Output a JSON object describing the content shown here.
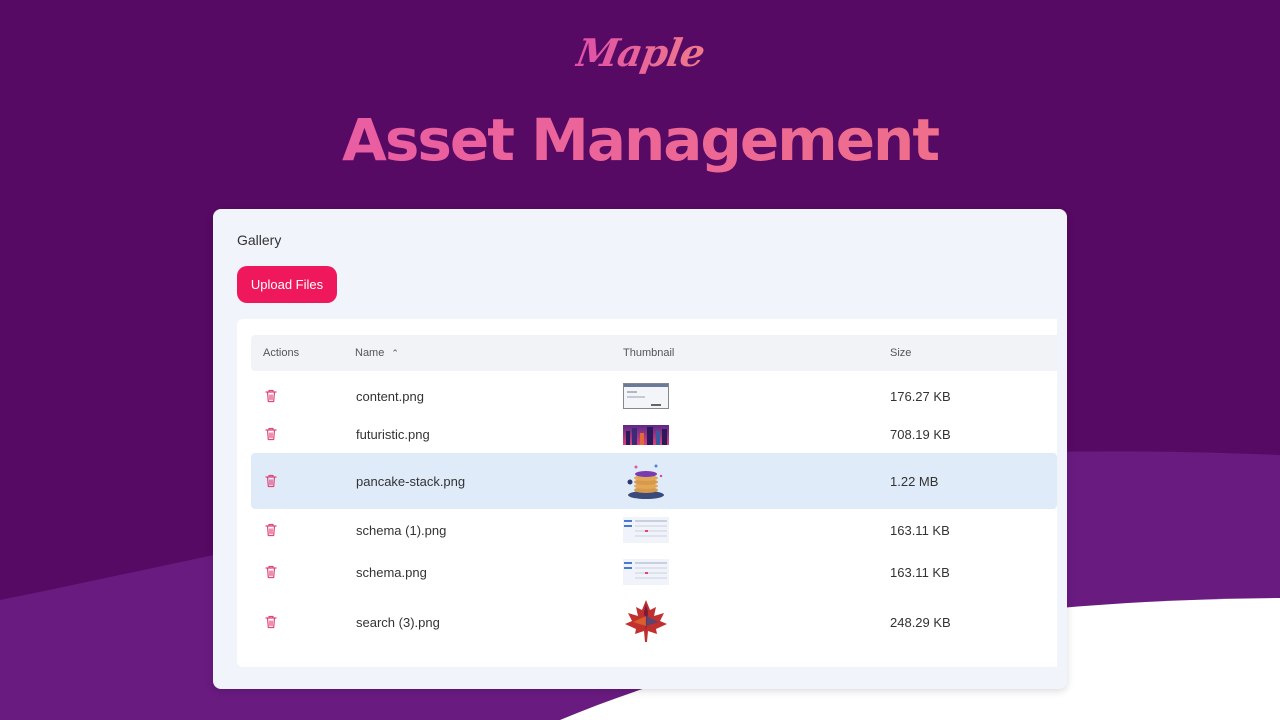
{
  "brand": {
    "logo_text": "Maple"
  },
  "hero": {
    "title": "Asset Management"
  },
  "gallery": {
    "title": "Gallery",
    "upload_label": "Upload Files",
    "columns": {
      "actions": "Actions",
      "name": "Name",
      "thumbnail": "Thumbnail",
      "size": "Size"
    },
    "sort": {
      "column": "Name",
      "direction": "ascending"
    },
    "rows": [
      {
        "name": "content.png",
        "size": "176.27 KB",
        "thumbnail": "screenshot-thumbnail",
        "selected": false
      },
      {
        "name": "futuristic.png",
        "size": "708.19 KB",
        "thumbnail": "city-image-thumbnail",
        "selected": false
      },
      {
        "name": "pancake-stack.png",
        "size": "1.22 MB",
        "thumbnail": "pancake-image-thumbnail",
        "selected": true
      },
      {
        "name": "schema (1).png",
        "size": "163.11 KB",
        "thumbnail": "schema-thumbnail",
        "selected": false
      },
      {
        "name": "schema.png",
        "size": "163.11 KB",
        "thumbnail": "schema-thumbnail",
        "selected": false
      },
      {
        "name": "search (3).png",
        "size": "248.29 KB",
        "thumbnail": "maple-leaf-thumbnail",
        "selected": false
      }
    ]
  },
  "colors": {
    "background": "#570a64",
    "accent": "#f0185c",
    "selected_row": "#e0ebfa",
    "trash_icon": "#e0457a"
  },
  "icons": {
    "delete": "trash-icon",
    "sort": "chevron-up-icon"
  }
}
